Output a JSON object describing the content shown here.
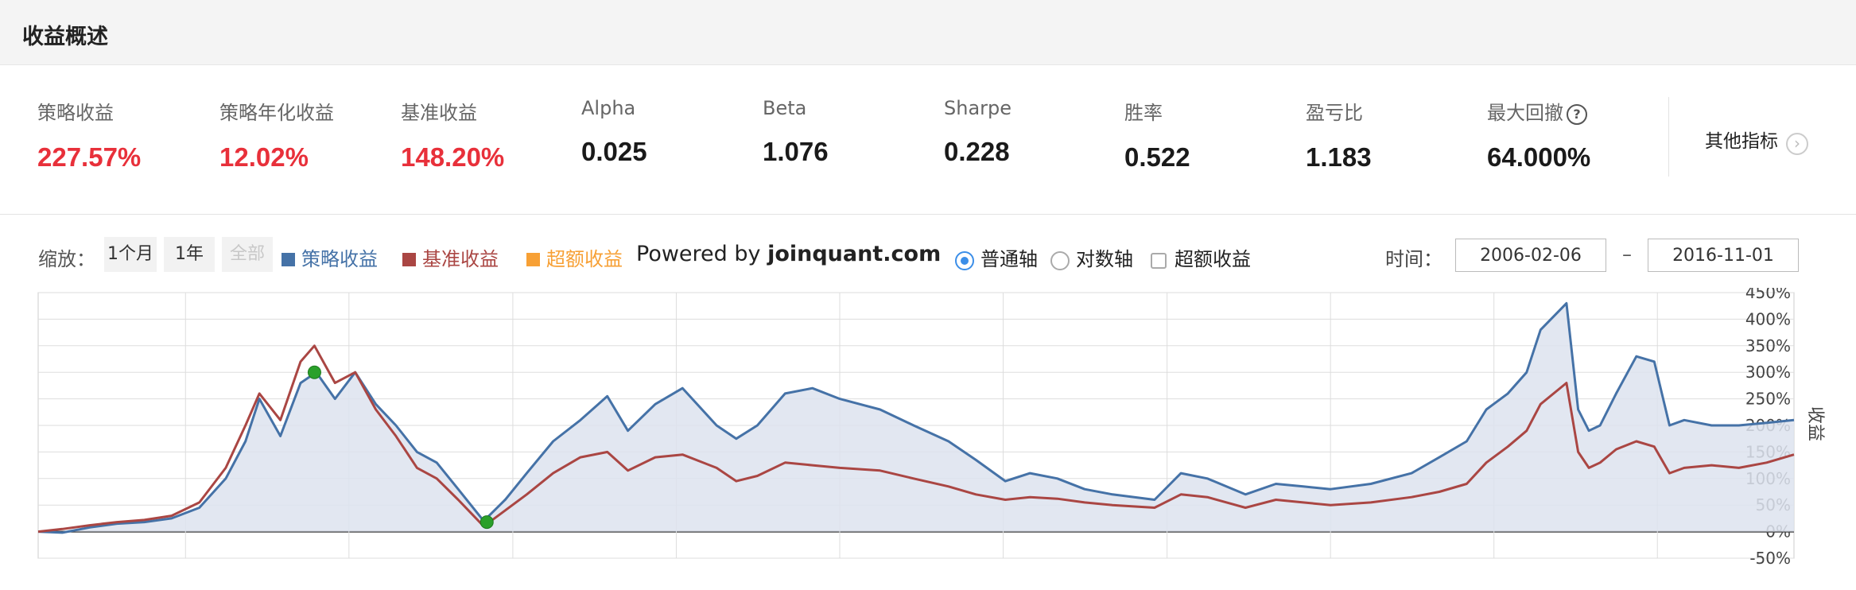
{
  "title": "收益概述",
  "metrics": [
    {
      "label": "策略收益",
      "value": "227.57%",
      "color": "red"
    },
    {
      "label": "策略年化收益",
      "value": "12.02%",
      "color": "red"
    },
    {
      "label": "基准收益",
      "value": "148.20%",
      "color": "red"
    },
    {
      "label": "Alpha",
      "value": "0.025",
      "color": "black"
    },
    {
      "label": "Beta",
      "value": "1.076",
      "color": "black"
    },
    {
      "label": "Sharpe",
      "value": "0.228",
      "color": "black"
    },
    {
      "label": "胜率",
      "value": "0.522",
      "color": "black"
    },
    {
      "label": "盈亏比",
      "value": "1.183",
      "color": "black"
    },
    {
      "label": "最大回撤",
      "value": "64.000%",
      "color": "black",
      "help_icon": "question-circle-icon"
    }
  ],
  "other_metrics": {
    "label": "其他指标",
    "icon": "chevron-right-circle-icon"
  },
  "controls": {
    "zoom_label": "缩放：",
    "zoom_buttons": [
      {
        "label": "1个月",
        "enabled": true
      },
      {
        "label": "1年",
        "enabled": true
      },
      {
        "label": "全部",
        "enabled": false
      }
    ],
    "legend": [
      {
        "label": "策略收益",
        "color": "#4572a7"
      },
      {
        "label": "基准收益",
        "color": "#aa4643"
      },
      {
        "label": "超额收益",
        "color": "#f7a035"
      }
    ],
    "powered_prefix": "Powered by ",
    "powered_brand": "joinquant.com",
    "axis_modes": [
      {
        "label": "普通轴",
        "selected": true
      },
      {
        "label": "对数轴",
        "selected": false
      }
    ],
    "excess_checkbox": {
      "label": "超额收益",
      "checked": false
    },
    "time_label": "时间：",
    "start_date": "2006-02-06",
    "end_date": "2016-11-01",
    "date_separator": "–"
  },
  "colors": {
    "strategy": "#4572a7",
    "benchmark": "#aa4643",
    "excess": "#f7a035",
    "red_value": "#e8303a",
    "area_fill": "#dde3ee",
    "drawdown_marker": "#2aa02a"
  },
  "chart_data": {
    "type": "line",
    "x_range": [
      "2006-02-06",
      "2016-11-01"
    ],
    "ylabel": "收益",
    "yticks": [
      "450%",
      "400%",
      "350%",
      "300%",
      "250%",
      "200%",
      "150%",
      "100%",
      "50%",
      "0%",
      "-50%"
    ],
    "ylim": [
      -50,
      450
    ],
    "grid": true,
    "legend_position": "top",
    "series": [
      {
        "name": "策略收益",
        "area": true,
        "x": [
          "2006-02-06",
          "2006-04-01",
          "2006-06-01",
          "2006-08-01",
          "2006-10-01",
          "2006-12-01",
          "2007-02-01",
          "2007-04-01",
          "2007-05-15",
          "2007-06-15",
          "2007-08-01",
          "2007-09-15",
          "2007-10-20",
          "2007-12-01",
          "2008-01-15",
          "2008-03-01",
          "2008-04-15",
          "2008-06-01",
          "2008-07-15",
          "2008-09-01",
          "2008-10-28",
          "2008-12-15",
          "2009-02-01",
          "2009-04-01",
          "2009-06-01",
          "2009-07-31",
          "2009-09-15",
          "2009-11-15",
          "2010-01-15",
          "2010-04-01",
          "2010-05-15",
          "2010-07-01",
          "2010-09-01",
          "2010-11-01",
          "2011-01-01",
          "2011-04-01",
          "2011-06-15",
          "2011-09-01",
          "2011-11-01",
          "2012-01-06",
          "2012-03-01",
          "2012-05-01",
          "2012-07-01",
          "2012-09-01",
          "2012-12-04",
          "2013-02-01",
          "2013-04-01",
          "2013-06-25",
          "2013-09-01",
          "2013-11-01",
          "2014-01-01",
          "2014-04-01",
          "2014-07-01",
          "2014-09-01",
          "2014-11-01",
          "2014-12-15",
          "2015-02-01",
          "2015-03-15",
          "2015-04-15",
          "2015-06-12",
          "2015-07-08",
          "2015-08-01",
          "2015-08-26",
          "2015-10-01",
          "2015-11-15",
          "2015-12-25",
          "2016-01-28",
          "2016-03-01",
          "2016-05-01",
          "2016-07-01",
          "2016-09-01",
          "2016-11-01"
        ],
        "values": [
          0,
          -2,
          8,
          15,
          18,
          25,
          45,
          100,
          170,
          250,
          180,
          280,
          300,
          250,
          300,
          240,
          200,
          150,
          130,
          80,
          20,
          60,
          110,
          170,
          210,
          255,
          190,
          240,
          270,
          200,
          175,
          200,
          260,
          270,
          250,
          230,
          200,
          170,
          135,
          95,
          110,
          100,
          80,
          70,
          60,
          110,
          100,
          70,
          90,
          85,
          80,
          90,
          110,
          140,
          170,
          230,
          260,
          300,
          380,
          430,
          230,
          190,
          200,
          260,
          330,
          320,
          200,
          210,
          200,
          200,
          205,
          210
        ]
      },
      {
        "name": "基准收益",
        "area": false,
        "x": [
          "2006-02-06",
          "2006-04-01",
          "2006-06-01",
          "2006-08-01",
          "2006-10-01",
          "2006-12-01",
          "2007-02-01",
          "2007-04-01",
          "2007-05-15",
          "2007-06-15",
          "2007-08-01",
          "2007-09-15",
          "2007-10-16",
          "2007-12-01",
          "2008-01-15",
          "2008-03-01",
          "2008-04-15",
          "2008-06-01",
          "2008-07-15",
          "2008-09-01",
          "2008-10-28",
          "2008-12-15",
          "2009-02-01",
          "2009-04-01",
          "2009-06-01",
          "2009-07-31",
          "2009-09-15",
          "2009-11-15",
          "2010-01-15",
          "2010-04-01",
          "2010-05-15",
          "2010-07-01",
          "2010-09-01",
          "2010-11-01",
          "2011-01-01",
          "2011-04-01",
          "2011-06-15",
          "2011-09-01",
          "2011-11-01",
          "2012-01-06",
          "2012-03-01",
          "2012-05-01",
          "2012-07-01",
          "2012-09-01",
          "2012-12-04",
          "2013-02-01",
          "2013-04-01",
          "2013-06-25",
          "2013-09-01",
          "2013-11-01",
          "2014-01-01",
          "2014-04-01",
          "2014-07-01",
          "2014-09-01",
          "2014-11-01",
          "2014-12-15",
          "2015-02-01",
          "2015-03-15",
          "2015-04-15",
          "2015-06-12",
          "2015-07-08",
          "2015-08-01",
          "2015-08-26",
          "2015-10-01",
          "2015-11-15",
          "2015-12-25",
          "2016-01-28",
          "2016-03-01",
          "2016-05-01",
          "2016-07-01",
          "2016-09-01",
          "2016-11-01"
        ],
        "values": [
          0,
          5,
          12,
          18,
          22,
          30,
          55,
          120,
          200,
          260,
          210,
          320,
          350,
          280,
          300,
          230,
          180,
          120,
          100,
          60,
          10,
          40,
          70,
          110,
          140,
          150,
          115,
          140,
          145,
          120,
          95,
          105,
          130,
          125,
          120,
          115,
          100,
          85,
          70,
          60,
          65,
          62,
          55,
          50,
          45,
          70,
          65,
          45,
          60,
          55,
          50,
          55,
          65,
          75,
          90,
          130,
          160,
          190,
          240,
          280,
          150,
          120,
          130,
          155,
          170,
          160,
          110,
          120,
          125,
          120,
          130,
          145
        ]
      }
    ],
    "drawdown_markers": [
      {
        "x": "2007-10-16",
        "value": 300
      },
      {
        "x": "2008-11-04",
        "value": 18
      }
    ]
  }
}
